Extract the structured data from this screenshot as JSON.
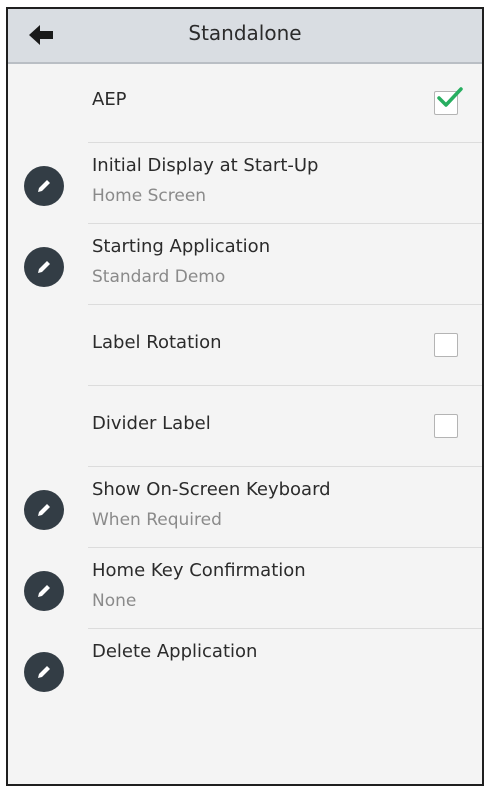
{
  "header": {
    "title": "Standalone",
    "back_icon": "arrow-left-icon"
  },
  "colors": {
    "header_bg": "#d9dde2",
    "edit_circle": "#333d45",
    "check_green": "#27ae60"
  },
  "items": [
    {
      "label": "AEP",
      "type": "checkbox",
      "checked": true
    },
    {
      "label": "Initial Display at Start-Up",
      "value": "Home Screen",
      "type": "edit"
    },
    {
      "label": "Starting Application",
      "value": "Standard Demo",
      "type": "edit"
    },
    {
      "label": "Label Rotation",
      "type": "checkbox",
      "checked": false
    },
    {
      "label": "Divider Label",
      "type": "checkbox",
      "checked": false
    },
    {
      "label": "Show On-Screen Keyboard",
      "value": "When Required",
      "type": "edit"
    },
    {
      "label": "Home Key Confirmation",
      "value": "None",
      "type": "edit"
    },
    {
      "label": "Delete Application",
      "type": "edit"
    }
  ]
}
